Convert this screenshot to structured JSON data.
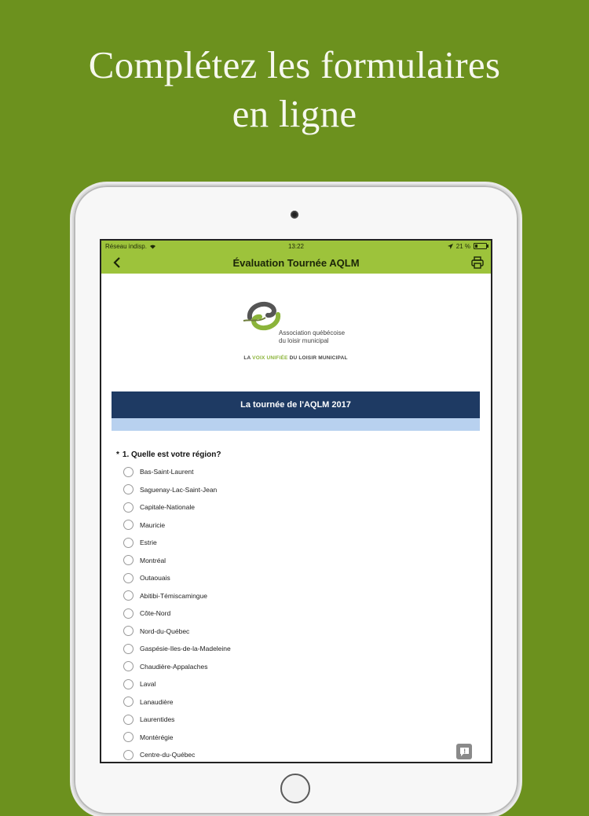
{
  "headline": {
    "line1": "Complétez les formulaires",
    "line2": "en ligne"
  },
  "status_bar": {
    "network": "Réseau indisp.",
    "time": "13:22",
    "battery": "21 %",
    "battery_level": 0.21
  },
  "nav": {
    "title": "Évaluation Tournée AQLM"
  },
  "logo": {
    "name_line1": "Association québécoise",
    "name_line2": "du loisir municipal",
    "tagline_prefix": "LA ",
    "tagline_green": "VOIX UNIFIÉE",
    "tagline_suffix": " DU LOISIR MUNICIPAL"
  },
  "banner": {
    "title": "La tournée de l'AQLM 2017"
  },
  "question": {
    "required_mark": "*",
    "text": "1. Quelle est votre région?",
    "options": [
      "Bas-Saint-Laurent",
      "Saguenay-Lac-Saint-Jean",
      "Capitale-Nationale",
      "Mauricie",
      "Estrie",
      "Montréal",
      "Outaouais",
      "Abitibi-Témiscamingue",
      "Côte-Nord",
      "Nord-du-Québec",
      "Gaspésie-Iles-de-la-Madeleine",
      "Chaudière-Appalaches",
      "Laval",
      "Lanaudière",
      "Laurentides",
      "Montérégie",
      "Centre-du-Québec"
    ]
  },
  "colors": {
    "background": "#6c911e",
    "app_bar": "#9dc33b",
    "banner": "#1e3a63",
    "banner_strip": "#b8d1ef"
  }
}
